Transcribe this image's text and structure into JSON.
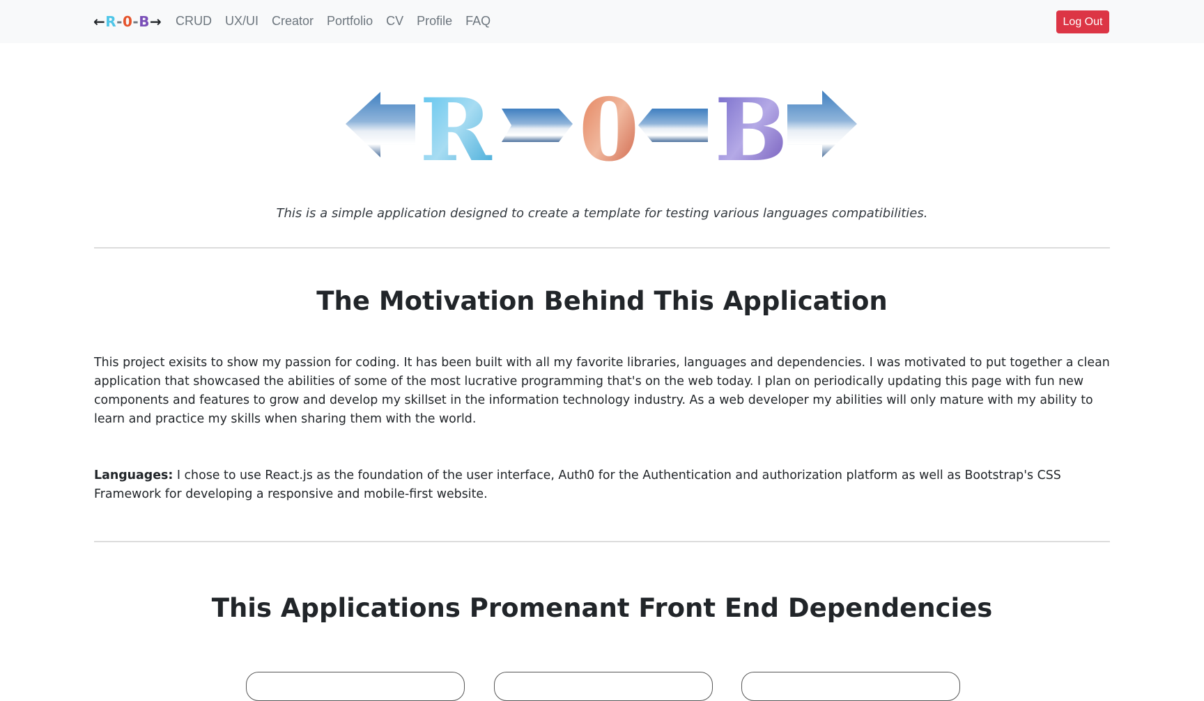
{
  "navbar": {
    "brand": {
      "left_arrow": "←",
      "r": "R",
      "dash1": "-",
      "o": "0",
      "dash2": "-",
      "b": "B",
      "right_arrow": "→"
    },
    "links": [
      "CRUD",
      "UX/UI",
      "Creator",
      "Portfolio",
      "CV",
      "Profile",
      "FAQ"
    ],
    "logout_label": "Log Out"
  },
  "hero": {
    "logo_letters": [
      "R",
      "0",
      "B"
    ],
    "tagline": "This is a simple application designed to create a template for testing various languages compatibilities."
  },
  "motivation": {
    "heading": "The Motivation Behind This Application",
    "paragraph": "This project exisits to show my passion for coding. It has been built with all my favorite libraries, languages and dependencies. I was motivated to put together a clean application that showcased the abilities of some of the most lucrative programming that's on the web today. I plan on periodically updating this page with fun new components and features to grow and develop my skillset in the information technology industry. As a web developer my abilities will only mature with my ability to learn and practice my skills when sharing them with the world.",
    "languages_label": "Languages:",
    "languages_text": " I chose to use React.js as the foundation of the user interface, Auth0 for the Authentication and authorization platform as well as Bootstrap's CSS Framework for developing a responsive and mobile-first website."
  },
  "dependencies": {
    "heading": "This Applications Promenant Front End Dependencies"
  },
  "colors": {
    "logout_bg": "#dc3545",
    "brand_r": "#4fc6e8",
    "brand_o": "#e5532b",
    "brand_b": "#7a4fb8"
  }
}
